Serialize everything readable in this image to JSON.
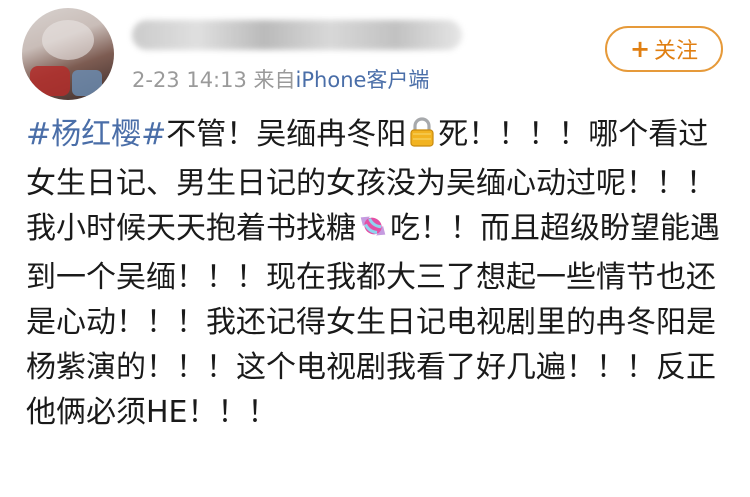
{
  "post": {
    "author": {
      "avatar_label": "user avatar"
    },
    "meta": {
      "time": "2-23 14:13",
      "from_prefix": "来自",
      "source": "iPhone客户端"
    },
    "follow_button": {
      "plus": "+",
      "label": "关注"
    },
    "content": {
      "hashtag": "#杨红樱#",
      "segment1": "不管！吴缅冉冬阳",
      "segment2": "死！！！！哪个看过女生日记、男生日记的女孩没为吴缅心动过呢！！！我小时候天天抱着书找糖",
      "segment3": "吃！！而且超级盼望能遇到一个吴缅！！！现在我都大三了想起一些情节也还是心动！！！我还记得女生日记电视剧里的冉冬阳是杨紫演的！！！这个电视剧我看了好几遍！！！反正他俩必须HE！！！",
      "emoji1": "lock-emoji",
      "emoji2": "candy-emoji"
    }
  },
  "colors": {
    "link": "#4a6ea8",
    "follow": "#e07f12",
    "text": "#1a1a1a",
    "meta": "#9a9a9a"
  }
}
